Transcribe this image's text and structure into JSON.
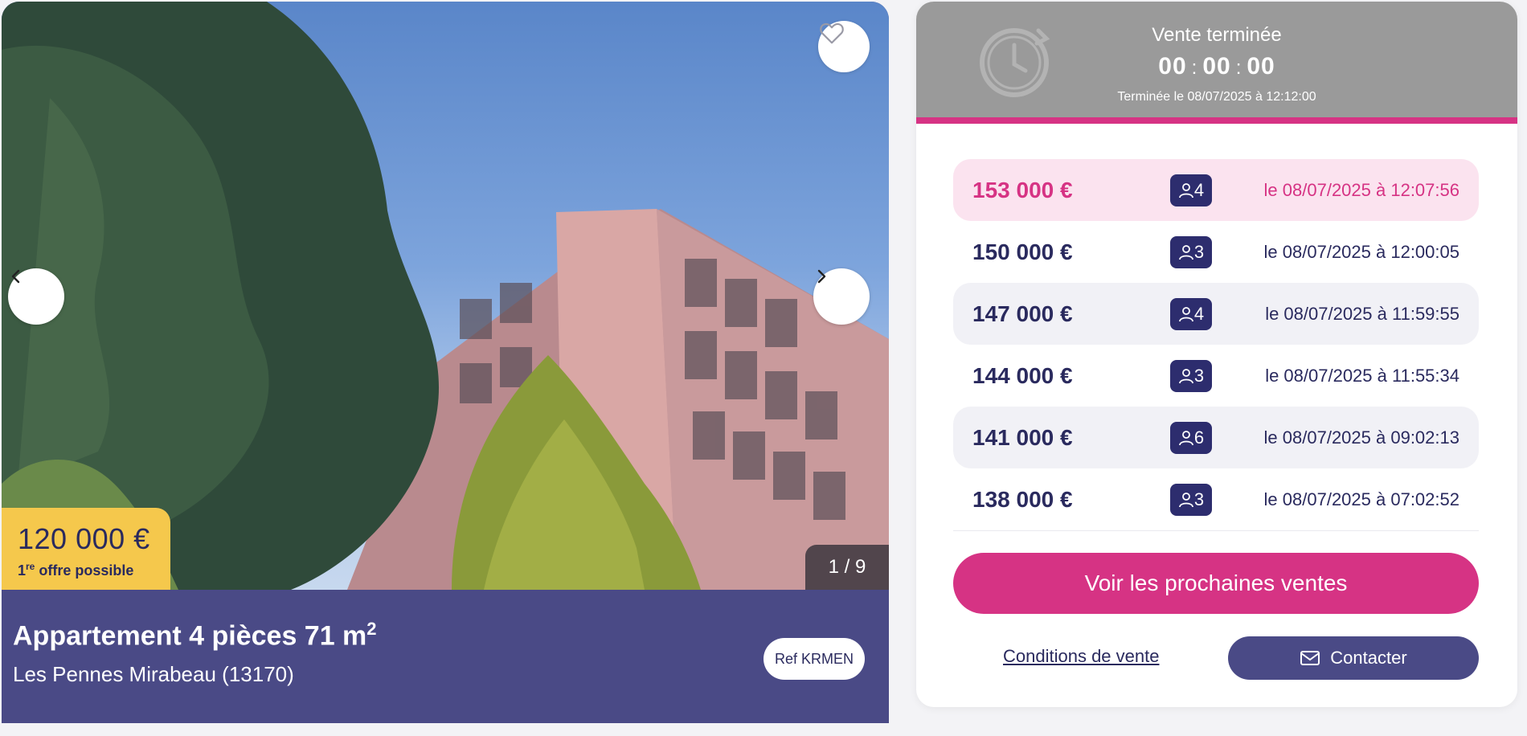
{
  "listing": {
    "price": "120 000 €",
    "price_note_prefix": "1",
    "price_note_sup": "re",
    "price_note_suffix": " offre possible",
    "photo_counter": "1 / 9",
    "title_main": "Appartement 4 pièces 71 m",
    "title_sup": "2",
    "location": "Les Pennes Mirabeau (13170)",
    "ref_label": "Ref KRMEN"
  },
  "auction": {
    "status": "Vente terminée",
    "timer": {
      "h": "00",
      "m": "00",
      "s": "00",
      "sep": ":"
    },
    "ended_text": "Terminée le 08/07/2025 à 12:12:00",
    "bids": [
      {
        "amount": "153 000 €",
        "bidders": "4",
        "date": "le 08/07/2025 à 12:07:56"
      },
      {
        "amount": "150 000 €",
        "bidders": "3",
        "date": "le 08/07/2025 à 12:00:05"
      },
      {
        "amount": "147 000 €",
        "bidders": "4",
        "date": "le 08/07/2025 à 11:59:55"
      },
      {
        "amount": "144 000 €",
        "bidders": "3",
        "date": "le 08/07/2025 à 11:55:34"
      },
      {
        "amount": "141 000 €",
        "bidders": "6",
        "date": "le 08/07/2025 à 09:02:13"
      },
      {
        "amount": "138 000 €",
        "bidders": "3",
        "date": "le 08/07/2025 à 07:02:52"
      }
    ],
    "cta_label": "Voir les prochaines ventes",
    "conditions_label": "Conditions de vente",
    "contact_label": "Contacter"
  },
  "icons": {
    "favorite": "heart-icon",
    "prev": "chevron-left-icon",
    "next": "chevron-right-icon",
    "timer": "clock-icon",
    "bidders": "user-icon",
    "contact": "mail-icon"
  },
  "colors": {
    "accent_pink": "#d63384",
    "navy": "#4a4a86",
    "badge_navy": "#2d2d6e",
    "price_yellow": "#f5c84c",
    "timer_gray": "#9a9a9a"
  }
}
